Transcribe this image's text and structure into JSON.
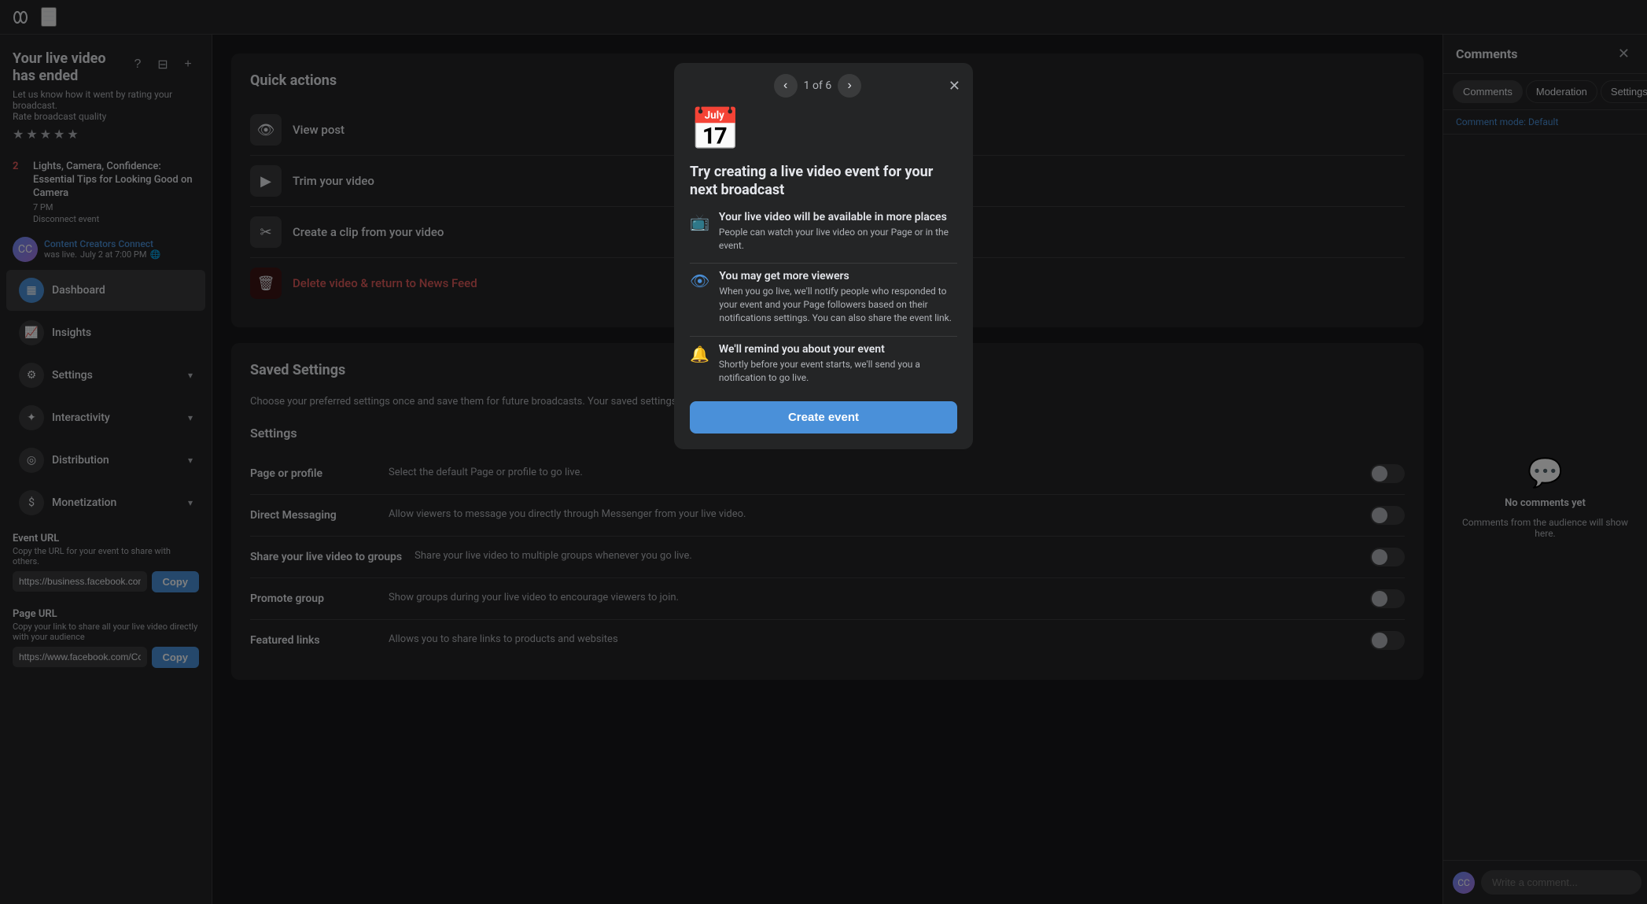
{
  "topbar": {
    "menu_label": "☰",
    "logo_label": "∞"
  },
  "sidebar": {
    "title": "Your live video has ended",
    "rating_label": "Rate broadcast quality",
    "broadcast": {
      "number": "2",
      "title": "Lights, Camera, Confidence: Essential Tips for Looking Good on Camera",
      "time": "7 PM",
      "disconnect": "Disconnect event"
    },
    "live_user": {
      "name": "Content Creators Connect",
      "meta": "July 2 at 7:00 PM",
      "was_live": "was live."
    },
    "nav_items": [
      {
        "id": "dashboard",
        "label": "Dashboard",
        "icon": "▦",
        "active": true,
        "has_chevron": false
      },
      {
        "id": "insights",
        "label": "Insights",
        "icon": "📈",
        "active": false,
        "has_chevron": false
      },
      {
        "id": "settings",
        "label": "Settings",
        "icon": "⚙",
        "active": false,
        "has_chevron": true
      },
      {
        "id": "interactivity",
        "label": "Interactivity",
        "icon": "✦",
        "active": false,
        "has_chevron": true
      },
      {
        "id": "distribution",
        "label": "Distribution",
        "icon": "◎",
        "active": false,
        "has_chevron": true
      },
      {
        "id": "monetization",
        "label": "Monetization",
        "icon": "$",
        "active": false,
        "has_chevron": true
      }
    ],
    "event_url": {
      "label": "Event URL",
      "desc": "Copy the URL for your event to share with others.",
      "value": "https://business.facebook.com/eve",
      "copy_label": "Copy"
    },
    "page_url": {
      "label": "Page URL",
      "desc": "Copy your link to share all your live video directly with your audience",
      "value": "https://www.facebook.com/Conter",
      "copy_label": "Copy"
    }
  },
  "quick_actions": {
    "title": "Quick actions",
    "items": [
      {
        "id": "view-post",
        "label": "View post",
        "icon": "👁"
      },
      {
        "id": "trim-video",
        "label": "Trim your video",
        "icon": "▶"
      },
      {
        "id": "create-clip",
        "label": "Create a clip from your video",
        "icon": "✂"
      },
      {
        "id": "delete-video",
        "label": "Delete video & return to News Feed",
        "icon": "🗑",
        "is_delete": true
      }
    ]
  },
  "saved_settings": {
    "title": "Saved Settings",
    "description": "Choose your preferred settings once and save them for future broadcasts. Your saved settings will be applied to live videos started in Live Producer.",
    "settings_label": "Settings",
    "rows": [
      {
        "id": "page-profile",
        "name": "Page or profile",
        "desc": "Select the default Page or profile to go live."
      },
      {
        "id": "direct-messaging",
        "name": "Direct Messaging",
        "desc": "Allow viewers to message you directly through Messenger from your live video."
      },
      {
        "id": "share-groups",
        "name": "Share your live video to groups",
        "desc": "Share your live video to multiple groups whenever you go live."
      },
      {
        "id": "promote-group",
        "name": "Promote group",
        "desc": "Show groups during your live video to encourage viewers to join."
      },
      {
        "id": "featured-links",
        "name": "Featured links",
        "desc": "Allows you to share links to products and websites"
      }
    ]
  },
  "modal": {
    "counter": "1 of 6",
    "title": "Try creating a live video event for your next broadcast",
    "icon": "📅",
    "features": [
      {
        "id": "more-places",
        "icon": "📺",
        "icon_color": "#4a90d9",
        "title": "Your live video will be available in more places",
        "desc": "People can watch your live video on your Page or in the event."
      },
      {
        "id": "more-viewers",
        "icon": "👁",
        "icon_color": "#4a90d9",
        "title": "You may get more viewers",
        "desc": "When you go live, we'll notify people who responded to your event and your Page followers based on their notifications settings. You can also share the event link."
      },
      {
        "id": "reminder",
        "icon": "🔔",
        "icon_color": "#f0c040",
        "title": "We'll remind you about your event",
        "desc": "Shortly before your event starts, we'll send you a notification to go live."
      }
    ],
    "cta_label": "Create event"
  },
  "right_panel": {
    "title": "Comments",
    "close_label": "✕",
    "tabs": [
      {
        "id": "comments",
        "label": "Comments",
        "active": true
      },
      {
        "id": "moderation",
        "label": "Moderation",
        "active": false
      },
      {
        "id": "settings",
        "label": "Settings",
        "active": false
      }
    ],
    "comment_mode_label": "Comment mode:",
    "comment_mode_value": "Default",
    "no_comments_label": "No comments yet",
    "no_comments_hint": "Comments from the audience will show here.",
    "comment_placeholder": "Write a comment..."
  }
}
